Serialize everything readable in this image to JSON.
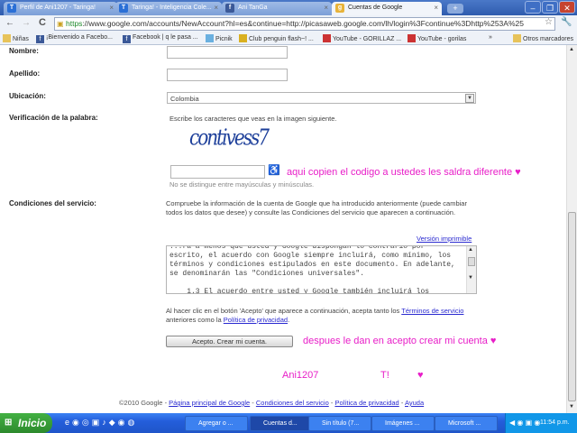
{
  "browser": {
    "tabs": [
      {
        "label": "Perfil de Ani1207 - Taringa!",
        "icon": "T"
      },
      {
        "label": "Taringa! - Inteligencia Cole...",
        "icon": "T"
      },
      {
        "label": "Ani TanGa",
        "icon": "f"
      },
      {
        "label": "Cuentas de Google",
        "icon": "g"
      }
    ],
    "new_tab": "+",
    "url_scheme": "https",
    "url_rest": "://www.google.com/accounts/NewAccount?hl=es&continue=http://picasaweb.google.com/lh/login%3Fcontinue%3Dhttp%253A%25",
    "bookmarks": [
      "Niñas",
      "¡Bienvenido a Facebo...",
      "Facebook | q le pasa ...",
      "Picnik",
      "Club penguin flash~! ...",
      "YouTube - GORILLAZ ...",
      "YouTube - gorilas"
    ],
    "bookmarks_overflow": "»",
    "other_bookmarks": "Otros marcadores"
  },
  "form": {
    "nombre_label": "Nombre:",
    "apellido_label": "Apellido:",
    "ubicacion_label": "Ubicación:",
    "ubicacion_value": "Colombia",
    "verificacion_label": "Verificación de la palabra:",
    "captcha_instruction": "Escribe los caracteres que veas en la imagen siguiente.",
    "captcha_text": "contivess7",
    "captcha_note": "No se distingue entre mayúsculas y minúsculas.",
    "condiciones_label": "Condiciones del servicio:",
    "condiciones_text": "Compruebe la información de la cuenta de Google que ha introducido anteriormente (puede cambiar todos los datos que desee) y consulte las Condiciones del servicio que aparecen a continuación.",
    "printable_link": "Versión imprimible",
    "tos_text": "...ra a menos que usted y Google dispongan lo contrario por escrito, el acuerdo con Google siempre incluirá, como mínimo, los términos y condiciones estipulados en este documento. En adelante, se denominarán las \"Condiciones universales\".\n\n    1.3 El acuerdo entre usted y Google también incluirá los",
    "accept_pre": "Al hacer clic en el botón 'Acepto' que aparece a continuación, acepta tanto los ",
    "accept_link1": "Términos de servicio",
    "accept_mid": " anteriores como la ",
    "accept_link2": "Política de privacidad",
    "accept_end": ".",
    "accept_button": "Acepto. Crear mi cuenta."
  },
  "annotations": {
    "captcha_note": "aqui copien el codigo a ustedes les saldra diferente ♥",
    "button_note": "despues le dan en acepto crear mi cuenta ♥",
    "author": "Ani1207",
    "site": "T!",
    "heart": "♥"
  },
  "footer": {
    "copyright": "©2010 Google - ",
    "links": [
      "Página principal de Google",
      "Condiciones del servicio",
      "Política de privacidad",
      "Ayuda"
    ],
    "sep": " - "
  },
  "taskbar": {
    "start": "Inicio",
    "tasks": [
      "Agregar o ...",
      "Cuentas d...",
      "Sin título (7...",
      "Imágenes ...",
      "Microsoft ..."
    ],
    "clock": "11:54 p.m."
  },
  "colors": {
    "annotation": "#e81ec8",
    "link": "#2a2ad0"
  }
}
